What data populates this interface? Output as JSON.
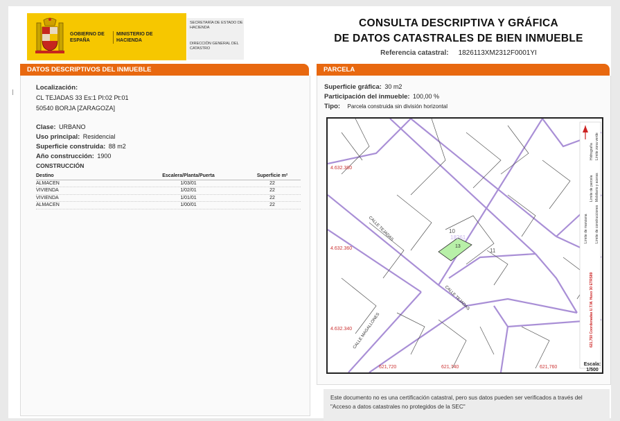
{
  "header": {
    "logo": {
      "gobierno": "GOBIERNO DE ESPAÑA",
      "ministerio": "MINISTERIO DE HACIENDA"
    },
    "secretaria": "SECRETARÍA DE ESTADO DE HACIENDA",
    "direccion": "DIRECCIÓN GENERAL DEL CATASTRO",
    "title_line1": "CONSULTA DESCRIPTIVA Y GRÁFICA",
    "title_line2": "DE DATOS CATASTRALES DE BIEN INMUEBLE",
    "ref_label": "Referencia catastral:",
    "ref_value": "1826113XM2312F0001YI"
  },
  "left": {
    "section_title": "DATOS DESCRIPTIVOS DEL INMUEBLE",
    "localizacion_label": "Localización:",
    "address_line1": "CL TEJADAS 33 Es:1 Pl:02 Pt:01",
    "address_line2": "50540 BORJA [ZARAGOZA]",
    "clase_label": "Clase:",
    "clase_value": "URBANO",
    "uso_label": "Uso principal:",
    "uso_value": "Residencial",
    "superficie_label": "Superficie construida:",
    "superficie_value": "88 m2",
    "anio_label": "Año construcción:",
    "anio_value": "1900",
    "construccion_title": "CONSTRUCCIÓN",
    "table_headers": [
      "Destino",
      "Escalera/Planta/Puerta",
      "Superficie m²"
    ],
    "table_rows": [
      [
        "ALMACEN",
        "1/03/01",
        "22"
      ],
      [
        "VIVIENDA",
        "1/02/01",
        "22"
      ],
      [
        "VIVIENDA",
        "1/01/01",
        "22"
      ],
      [
        "ALMACEN",
        "1/00/01",
        "22"
      ]
    ]
  },
  "right": {
    "section_title": "PARCELA",
    "superficie_label": "Superficie gráfica:",
    "superficie_value": "30 m2",
    "participacion_label": "Participación del inmueble:",
    "participacion_value": "100,00 %",
    "tipo_label": "Tipo:",
    "tipo_value": "Parcela construida sin división horizontal",
    "map": {
      "y_labels": [
        "4.632.380",
        "4.632.360",
        "4.632.340"
      ],
      "x_labels": [
        "621,720",
        "621,740",
        "621,760"
      ],
      "street_labels": [
        "CALLE TEJADAS",
        "CALLE TEJADAS",
        "CALLE MAGALLONES"
      ],
      "parcel_numbers": [
        "10",
        "13",
        "11",
        "18261"
      ],
      "legend": [
        "Límite de manzana",
        "Límite de parcela",
        "Límite de construcciones",
        "Mobiliario y aceras",
        "Límite zona verde",
        "Hidrografía"
      ],
      "coord_note": "621,750 Coordenadas U.T.M. Huso 30 ETRS89",
      "scale_label": "Escala:",
      "scale_value": "1/500",
      "accent_color": "#a98fd6",
      "parcel_color": "#b8f0a8"
    }
  },
  "footer_note": "Este documento no es una certificación catastral, pero sus datos pueden ser verificados a través del \"Acceso a datos catastrales no protegidos de la SEC\""
}
